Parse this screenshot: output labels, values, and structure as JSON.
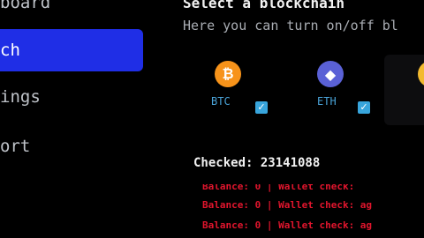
{
  "sidebar": {
    "items": [
      {
        "label": "board"
      },
      {
        "label": "ch"
      },
      {
        "label": "ings"
      },
      {
        "label": "ort"
      }
    ]
  },
  "main": {
    "title": "Select a blockchain",
    "subtitle": "Here you can turn on/off bl",
    "chains": [
      {
        "ticker": "BTC",
        "checked": true,
        "color": "#f7931a"
      },
      {
        "ticker": "ETH",
        "checked": true,
        "color": "#5a61d6"
      },
      {
        "ticker": "",
        "checked": false,
        "color": "#f3ba2f"
      }
    ],
    "checked_label": "Checked: 23141088",
    "log": [
      "Balance: 0 | Wallet check:",
      "Balance: 0 | Wallet check: ag",
      "Balance: 0 | Wallet check: ag"
    ]
  },
  "colors": {
    "active_nav": "#1f2ee6",
    "accent": "#38a5dc",
    "log_red": "#e0152d"
  }
}
